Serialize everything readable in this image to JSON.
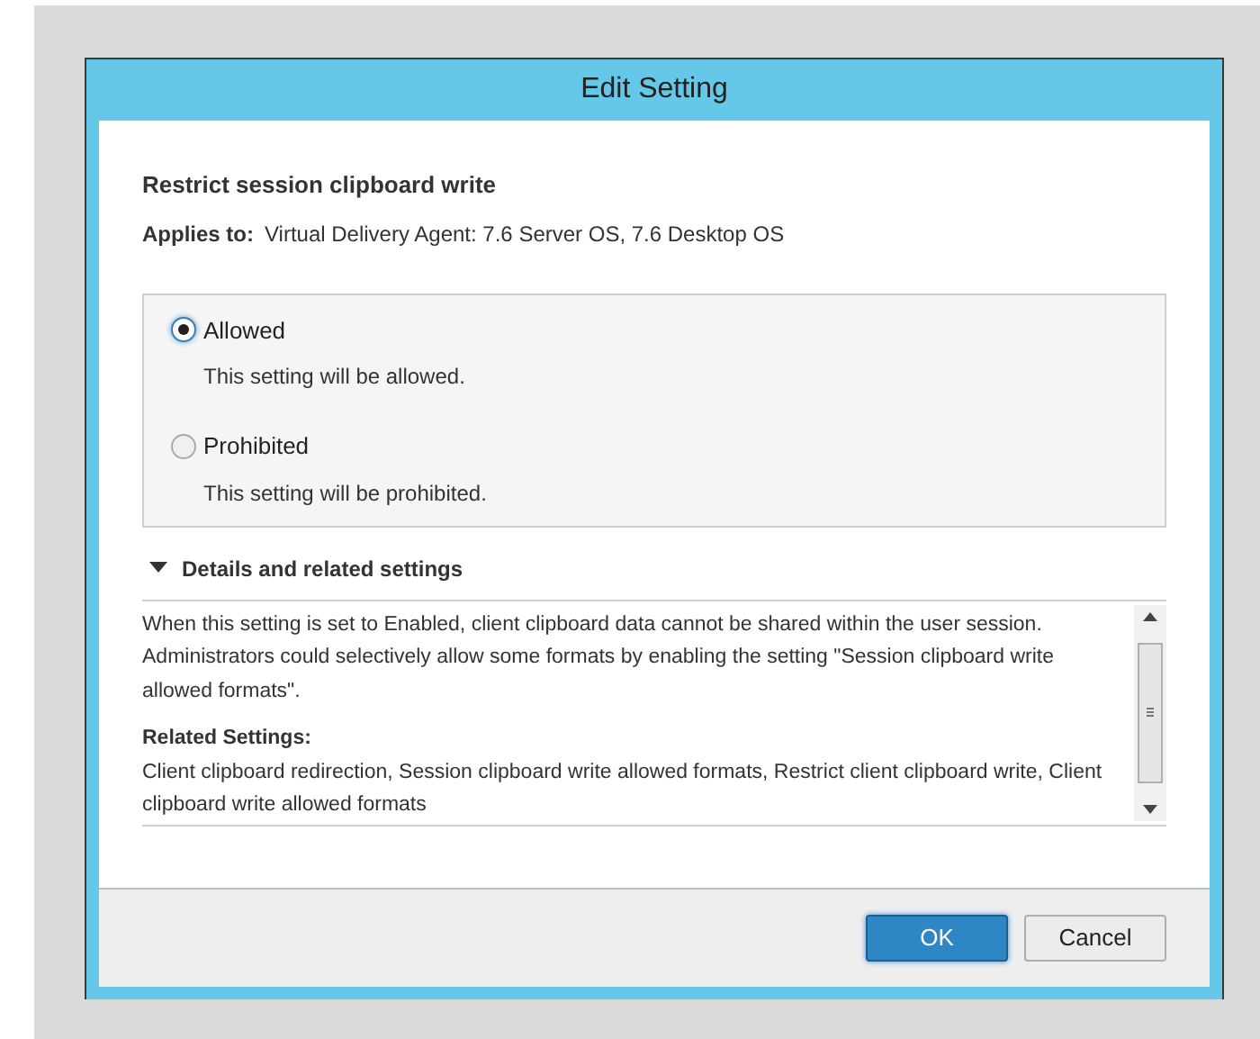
{
  "window": {
    "title": "Edit Setting"
  },
  "setting": {
    "name": "Restrict session clipboard write",
    "applies_label": "Applies to:",
    "applies_value": "Virtual Delivery Agent: 7.6 Server OS, 7.6 Desktop OS"
  },
  "options": [
    {
      "label": "Allowed",
      "description": "This setting will be allowed.",
      "selected": true
    },
    {
      "label": "Prohibited",
      "description": "This setting will be prohibited.",
      "selected": false
    }
  ],
  "details": {
    "title": "Details and related settings",
    "expanded": true,
    "description": "When this setting is set to Enabled, client clipboard data cannot be shared within the user session. Administrators could selectively allow some formats by enabling the setting \"Session clipboard write allowed formats\".",
    "related_title": "Related Settings:",
    "related": "Client clipboard redirection, Session clipboard write allowed formats, Restrict client clipboard write, Client clipboard write allowed formats"
  },
  "buttons": [
    {
      "label": "OK",
      "kind": "primary"
    },
    {
      "label": "Cancel",
      "kind": "secondary"
    }
  ]
}
